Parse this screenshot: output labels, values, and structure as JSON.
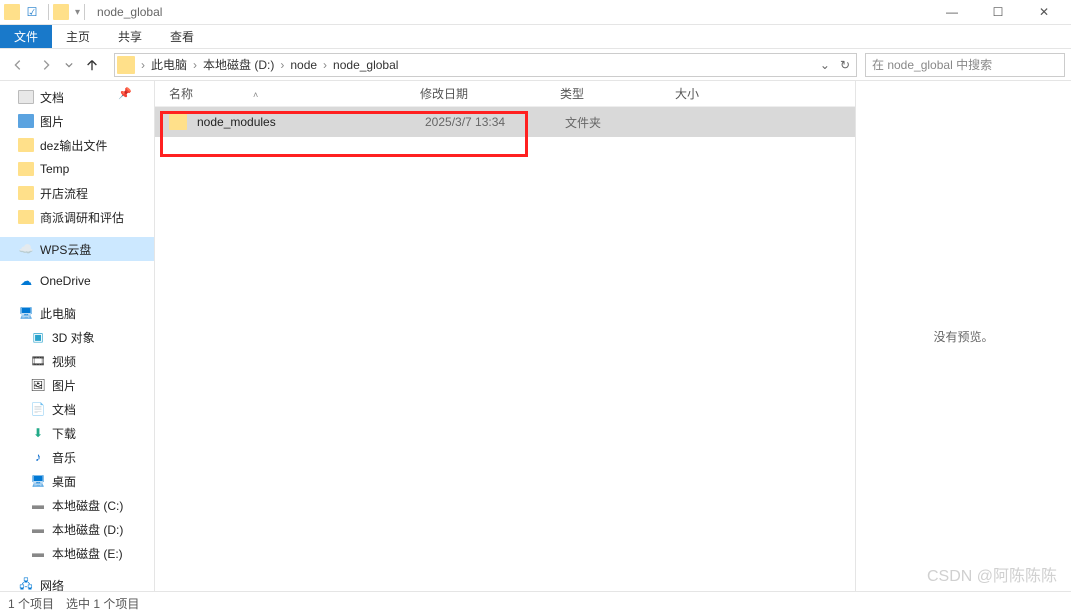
{
  "window": {
    "title": "node_global",
    "minimize": "—",
    "maximize": "☐",
    "close": "✕"
  },
  "ribbon": {
    "tabs": [
      "文件",
      "主页",
      "共享",
      "查看"
    ],
    "activeIndex": 0
  },
  "navigation": {
    "breadcrumbs": [
      "此电脑",
      "本地磁盘 (D:)",
      "node",
      "node_global"
    ],
    "searchPlaceholder": "在 node_global 中搜索"
  },
  "sidebar": {
    "quick": [
      {
        "label": "文档",
        "icon": "doc"
      },
      {
        "label": "图片",
        "icon": "blue"
      },
      {
        "label": "dez输出文件",
        "icon": "folder"
      },
      {
        "label": "Temp",
        "icon": "folder"
      },
      {
        "label": "开店流程",
        "icon": "folder"
      },
      {
        "label": "商派调研和评估",
        "icon": "folder"
      }
    ],
    "cloud": [
      {
        "label": "WPS云盘",
        "icon": "wps",
        "selected": true
      },
      {
        "label": "OneDrive",
        "icon": "onedrive"
      }
    ],
    "thispc": {
      "label": "此电脑",
      "children": [
        {
          "label": "3D 对象",
          "icon": "3d"
        },
        {
          "label": "视频",
          "icon": "video"
        },
        {
          "label": "图片",
          "icon": "pic"
        },
        {
          "label": "文档",
          "icon": "doc"
        },
        {
          "label": "下载",
          "icon": "download"
        },
        {
          "label": "音乐",
          "icon": "music"
        },
        {
          "label": "桌面",
          "icon": "desktop"
        },
        {
          "label": "本地磁盘 (C:)",
          "icon": "disk"
        },
        {
          "label": "本地磁盘 (D:)",
          "icon": "disk"
        },
        {
          "label": "本地磁盘 (E:)",
          "icon": "disk"
        }
      ]
    },
    "network": {
      "label": "网络"
    }
  },
  "columns": {
    "name": "名称",
    "date": "修改日期",
    "type": "类型",
    "size": "大小"
  },
  "files": [
    {
      "name": "node_modules",
      "date": "2025/3/7 13:34",
      "type": "文件夹",
      "size": ""
    }
  ],
  "preview": {
    "empty": "没有预览。"
  },
  "statusbar": {
    "count": "1 个项目",
    "selected": "选中 1 个项目"
  },
  "watermark": "CSDN @阿陈陈陈"
}
